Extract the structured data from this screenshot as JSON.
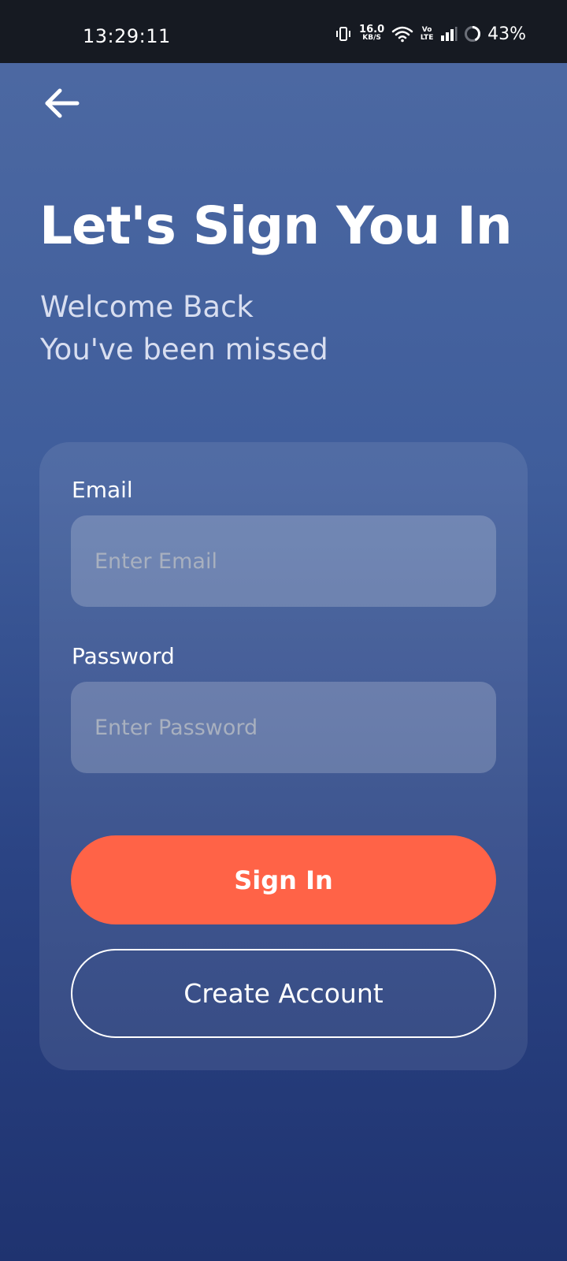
{
  "status_bar": {
    "time": "13:29:11",
    "net_speed_value": "16.0",
    "net_speed_unit": "KB/S",
    "volte_top": "Vo",
    "volte_bottom": "LTE",
    "battery_percent": "43%"
  },
  "header": {
    "back_icon": "arrow-left-icon",
    "title": "Let's Sign You In",
    "subtitle_line1": "Welcome Back",
    "subtitle_line2": "You've been missed"
  },
  "form": {
    "email_label": "Email",
    "email_value": "",
    "email_placeholder": "Enter Email",
    "password_label": "Password",
    "password_value": "",
    "password_placeholder": "Enter Password",
    "signin_label": "Sign In",
    "create_account_label": "Create Account"
  },
  "colors": {
    "accent": "#ff6347",
    "status_bar_bg": "#161a22",
    "background_top": "#4e6aa3",
    "background_bottom": "#1f3370"
  }
}
